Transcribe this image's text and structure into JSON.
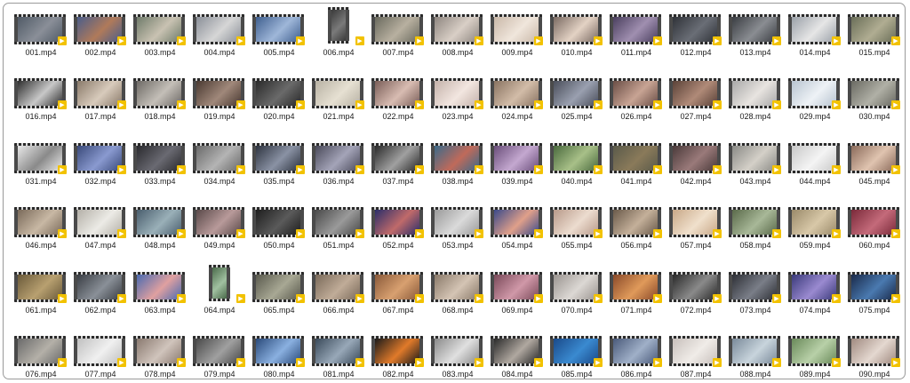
{
  "window": {
    "title": ""
  },
  "badge_color": "#f2c200",
  "files": [
    {
      "name": "001.mp4",
      "icon": "video-file-icon",
      "colors": [
        "#505a66",
        "#8a8f98"
      ]
    },
    {
      "name": "002.mp4",
      "icon": "video-file-icon",
      "colors": [
        "#4a5d8a",
        "#b07a5a"
      ]
    },
    {
      "name": "003.mp4",
      "icon": "video-file-icon",
      "colors": [
        "#6f7b6a",
        "#c9c2b2"
      ]
    },
    {
      "name": "004.mp4",
      "icon": "video-file-icon",
      "colors": [
        "#8a8f98",
        "#d6d6d6"
      ]
    },
    {
      "name": "005.mp4",
      "icon": "video-file-icon",
      "colors": [
        "#3f5f8f",
        "#9fb7d9"
      ]
    },
    {
      "name": "006.mp4",
      "icon": "video-file-icon",
      "colors": [
        "#3a3a3a",
        "#7a7a7a"
      ],
      "portrait": true
    },
    {
      "name": "007.mp4",
      "icon": "video-file-icon",
      "colors": [
        "#6a6a5e",
        "#b8b0a0"
      ]
    },
    {
      "name": "008.mp4",
      "icon": "video-file-icon",
      "colors": [
        "#8e8680",
        "#d9cfc6"
      ]
    },
    {
      "name": "009.mp4",
      "icon": "video-file-icon",
      "colors": [
        "#c9b8a8",
        "#f0e6dc"
      ]
    },
    {
      "name": "010.mp4",
      "icon": "video-file-icon",
      "colors": [
        "#7a6a62",
        "#e3d2c4"
      ]
    },
    {
      "name": "011.mp4",
      "icon": "video-file-icon",
      "colors": [
        "#4a3f5e",
        "#a08fb0"
      ]
    },
    {
      "name": "012.mp4",
      "icon": "video-file-icon",
      "colors": [
        "#2f3238",
        "#6a6e76"
      ]
    },
    {
      "name": "013.mp4",
      "icon": "video-file-icon",
      "colors": [
        "#3a3d42",
        "#8a8d92"
      ]
    },
    {
      "name": "014.mp4",
      "icon": "video-file-icon",
      "colors": [
        "#9aa0a8",
        "#e6e6e6"
      ]
    },
    {
      "name": "015.mp4",
      "icon": "video-file-icon",
      "colors": [
        "#6a6e58",
        "#b0ad92"
      ]
    },
    {
      "name": "016.mp4",
      "icon": "video-file-icon",
      "colors": [
        "#2f2f2f",
        "#c8c8c8"
      ]
    },
    {
      "name": "017.mp4",
      "icon": "video-file-icon",
      "colors": [
        "#8a7a6a",
        "#d8cbbc"
      ]
    },
    {
      "name": "018.mp4",
      "icon": "video-file-icon",
      "colors": [
        "#6e6a66",
        "#c4bfb8"
      ]
    },
    {
      "name": "019.mp4",
      "icon": "video-file-icon",
      "colors": [
        "#4a3a32",
        "#a0887a"
      ]
    },
    {
      "name": "020.mp4",
      "icon": "video-file-icon",
      "colors": [
        "#2a2a2a",
        "#6a6a6a"
      ]
    },
    {
      "name": "021.mp4",
      "icon": "video-file-icon",
      "colors": [
        "#b8b2a4",
        "#e6e0d2"
      ]
    },
    {
      "name": "022.mp4",
      "icon": "video-file-icon",
      "colors": [
        "#7a5e58",
        "#d8bcb2"
      ]
    },
    {
      "name": "023.mp4",
      "icon": "video-file-icon",
      "colors": [
        "#c4b2aa",
        "#f2e6e0"
      ]
    },
    {
      "name": "024.mp4",
      "icon": "video-file-icon",
      "colors": [
        "#8a7462",
        "#d2bca8"
      ]
    },
    {
      "name": "025.mp4",
      "icon": "video-file-icon",
      "colors": [
        "#4a4e5a",
        "#9aa0b0"
      ]
    },
    {
      "name": "026.mp4",
      "icon": "video-file-icon",
      "colors": [
        "#6a4e46",
        "#c8a494"
      ]
    },
    {
      "name": "027.mp4",
      "icon": "video-file-icon",
      "colors": [
        "#5a4238",
        "#b08a78"
      ]
    },
    {
      "name": "028.mp4",
      "icon": "video-file-icon",
      "colors": [
        "#a8a8a8",
        "#e8e4e0"
      ]
    },
    {
      "name": "029.mp4",
      "icon": "video-file-icon",
      "colors": [
        "#b8c4d0",
        "#eef2f6"
      ]
    },
    {
      "name": "030.mp4",
      "icon": "video-file-icon",
      "colors": [
        "#6a6a62",
        "#b0b0a6"
      ]
    },
    {
      "name": "031.mp4",
      "icon": "video-file-icon",
      "colors": [
        "#e8e8e8",
        "#8a8a8a"
      ]
    },
    {
      "name": "032.mp4",
      "icon": "video-file-icon",
      "colors": [
        "#3a4a7a",
        "#8a9ad0"
      ]
    },
    {
      "name": "033.mp4",
      "icon": "video-file-icon",
      "colors": [
        "#2a2a2e",
        "#6a6a72"
      ]
    },
    {
      "name": "034.mp4",
      "icon": "video-file-icon",
      "colors": [
        "#6a6a6a",
        "#b4b4b4"
      ]
    },
    {
      "name": "035.mp4",
      "icon": "video-file-icon",
      "colors": [
        "#2e3440",
        "#8a92a4"
      ]
    },
    {
      "name": "036.mp4",
      "icon": "video-file-icon",
      "colors": [
        "#4a4a5a",
        "#a4a4b8"
      ]
    },
    {
      "name": "037.mp4",
      "icon": "video-file-icon",
      "colors": [
        "#2a2a2a",
        "#a0a0a0"
      ]
    },
    {
      "name": "038.mp4",
      "icon": "video-file-icon",
      "colors": [
        "#3a6a8a",
        "#c06a5a"
      ]
    },
    {
      "name": "039.mp4",
      "icon": "video-file-icon",
      "colors": [
        "#6a4e7a",
        "#c4a8d0"
      ]
    },
    {
      "name": "040.mp4",
      "icon": "video-file-icon",
      "colors": [
        "#4a6a3e",
        "#a8c088"
      ]
    },
    {
      "name": "041.mp4",
      "icon": "video-file-icon",
      "colors": [
        "#5a5a4a",
        "#8a7a5a"
      ]
    },
    {
      "name": "042.mp4",
      "icon": "video-file-icon",
      "colors": [
        "#4a3a3a",
        "#9a7a7a"
      ]
    },
    {
      "name": "043.mp4",
      "icon": "video-file-icon",
      "colors": [
        "#8a8a86",
        "#d4d0c8"
      ]
    },
    {
      "name": "044.mp4",
      "icon": "video-file-icon",
      "colors": [
        "#c8c8c8",
        "#f4f4f4"
      ]
    },
    {
      "name": "045.mp4",
      "icon": "video-file-icon",
      "colors": [
        "#8a6a5a",
        "#e0c4b0"
      ]
    },
    {
      "name": "046.mp4",
      "icon": "video-file-icon",
      "colors": [
        "#7a6a5a",
        "#c8b8a4"
      ]
    },
    {
      "name": "047.mp4",
      "icon": "video-file-icon",
      "colors": [
        "#b4b0a8",
        "#ecebe6"
      ]
    },
    {
      "name": "048.mp4",
      "icon": "video-file-icon",
      "colors": [
        "#4a5e6e",
        "#9ab0b8"
      ]
    },
    {
      "name": "049.mp4",
      "icon": "video-file-icon",
      "colors": [
        "#5a4a4a",
        "#b89a9a"
      ]
    },
    {
      "name": "050.mp4",
      "icon": "video-file-icon",
      "colors": [
        "#1e1e1e",
        "#5a5a5a"
      ]
    },
    {
      "name": "051.mp4",
      "icon": "video-file-icon",
      "colors": [
        "#4a4a4a",
        "#9a9a9a"
      ]
    },
    {
      "name": "052.mp4",
      "icon": "video-file-icon",
      "colors": [
        "#2a2e6a",
        "#c06a6a"
      ]
    },
    {
      "name": "053.mp4",
      "icon": "video-file-icon",
      "colors": [
        "#9a9a9a",
        "#dadada"
      ]
    },
    {
      "name": "054.mp4",
      "icon": "video-file-icon",
      "colors": [
        "#3a4a8a",
        "#e0a08a"
      ]
    },
    {
      "name": "055.mp4",
      "icon": "video-file-icon",
      "colors": [
        "#b89a8a",
        "#ecdccf"
      ]
    },
    {
      "name": "056.mp4",
      "icon": "video-file-icon",
      "colors": [
        "#6a5a4a",
        "#c4b09a"
      ]
    },
    {
      "name": "057.mp4",
      "icon": "video-file-icon",
      "colors": [
        "#c8a888",
        "#f0e0cc"
      ]
    },
    {
      "name": "058.mp4",
      "icon": "video-file-icon",
      "colors": [
        "#5a6a4a",
        "#a8b898"
      ]
    },
    {
      "name": "059.mp4",
      "icon": "video-file-icon",
      "colors": [
        "#9a8a6a",
        "#d8c8a8"
      ]
    },
    {
      "name": "060.mp4",
      "icon": "video-file-icon",
      "colors": [
        "#7a2a3a",
        "#c46a7a"
      ]
    },
    {
      "name": "061.mp4",
      "icon": "video-file-icon",
      "colors": [
        "#6a5a3a",
        "#b8a070"
      ]
    },
    {
      "name": "062.mp4",
      "icon": "video-file-icon",
      "colors": [
        "#3a3e44",
        "#8a9098"
      ]
    },
    {
      "name": "063.mp4",
      "icon": "video-file-icon",
      "colors": [
        "#4a6ab0",
        "#e0a0a0"
      ]
    },
    {
      "name": "064.mp4",
      "icon": "video-file-icon",
      "colors": [
        "#4a6a4a",
        "#a0c0a0"
      ],
      "portrait": true
    },
    {
      "name": "065.mp4",
      "icon": "video-file-icon",
      "colors": [
        "#5a5a4e",
        "#a8a894"
      ]
    },
    {
      "name": "066.mp4",
      "icon": "video-file-icon",
      "colors": [
        "#7a6a5a",
        "#c0ac98"
      ]
    },
    {
      "name": "067.mp4",
      "icon": "video-file-icon",
      "colors": [
        "#8a5a3a",
        "#d8a070"
      ]
    },
    {
      "name": "068.mp4",
      "icon": "video-file-icon",
      "colors": [
        "#8a7a6a",
        "#d4c4b4"
      ]
    },
    {
      "name": "069.mp4",
      "icon": "video-file-icon",
      "colors": [
        "#7a4a5a",
        "#d098a8"
      ]
    },
    {
      "name": "070.mp4",
      "icon": "video-file-icon",
      "colors": [
        "#9a9490",
        "#dcd8d4"
      ]
    },
    {
      "name": "071.mp4",
      "icon": "video-file-icon",
      "colors": [
        "#8a4a2a",
        "#e09a5a"
      ]
    },
    {
      "name": "072.mp4",
      "icon": "video-file-icon",
      "colors": [
        "#2a2a2a",
        "#8a8a8a"
      ]
    },
    {
      "name": "073.mp4",
      "icon": "video-file-icon",
      "colors": [
        "#2e3036",
        "#7a7e88"
      ]
    },
    {
      "name": "074.mp4",
      "icon": "video-file-icon",
      "colors": [
        "#3a3a7a",
        "#9a8ad0"
      ]
    },
    {
      "name": "075.mp4",
      "icon": "video-file-icon",
      "colors": [
        "#1a2a4a",
        "#4a7ab0"
      ]
    },
    {
      "name": "076.mp4",
      "icon": "video-file-icon",
      "colors": [
        "#6a6a6a",
        "#b4b0a8"
      ]
    },
    {
      "name": "077.mp4",
      "icon": "video-file-icon",
      "colors": [
        "#c0c0c0",
        "#f0f0f0"
      ]
    },
    {
      "name": "078.mp4",
      "icon": "video-file-icon",
      "colors": [
        "#8a7a70",
        "#d0c4bc"
      ]
    },
    {
      "name": "079.mp4",
      "icon": "video-file-icon",
      "colors": [
        "#4a4a4a",
        "#a0a0a0"
      ]
    },
    {
      "name": "080.mp4",
      "icon": "video-file-icon",
      "colors": [
        "#2a4a7a",
        "#8ab0e0"
      ]
    },
    {
      "name": "081.mp4",
      "icon": "video-file-icon",
      "colors": [
        "#3a4a5a",
        "#98a8b8"
      ]
    },
    {
      "name": "082.mp4",
      "icon": "video-file-icon",
      "colors": [
        "#1a1a1a",
        "#e07a2a"
      ]
    },
    {
      "name": "083.mp4",
      "icon": "video-file-icon",
      "colors": [
        "#8a8a8a",
        "#e0e0e0"
      ]
    },
    {
      "name": "084.mp4",
      "icon": "video-file-icon",
      "colors": [
        "#2a2a2a",
        "#b0a8a0"
      ]
    },
    {
      "name": "085.mp4",
      "icon": "video-file-icon",
      "colors": [
        "#1a4a8a",
        "#3a8ad0"
      ]
    },
    {
      "name": "086.mp4",
      "icon": "video-file-icon",
      "colors": [
        "#4a5a7a",
        "#a0b0c8"
      ]
    },
    {
      "name": "087.mp4",
      "icon": "video-file-icon",
      "colors": [
        "#c8c0bc",
        "#f0ece8"
      ]
    },
    {
      "name": "088.mp4",
      "icon": "video-file-icon",
      "colors": [
        "#7a8a9a",
        "#c8d4dc"
      ]
    },
    {
      "name": "089.mp4",
      "icon": "video-file-icon",
      "colors": [
        "#6a8a5a",
        "#b8d0a8"
      ]
    },
    {
      "name": "090.mp4",
      "icon": "video-file-icon",
      "colors": [
        "#a08a80",
        "#e4d8d0"
      ]
    }
  ]
}
